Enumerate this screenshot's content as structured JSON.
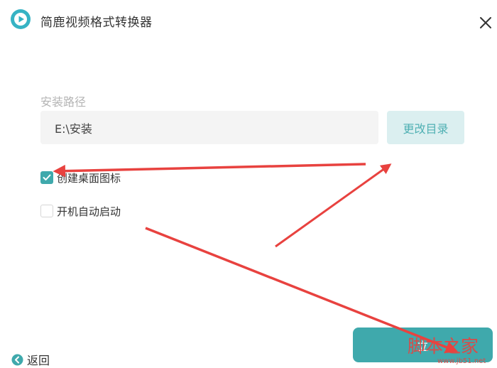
{
  "window": {
    "title": "简鹿视频格式转换器",
    "logo_icon": "play-logo-icon",
    "close_icon": "close-icon"
  },
  "install": {
    "path_label": "安装路径",
    "path_value": "E:\\安装",
    "change_dir_label": "更改目录",
    "install_label": "立"
  },
  "options": [
    {
      "label": "创建桌面图标",
      "checked": true
    },
    {
      "label": "开机自动启动",
      "checked": false
    }
  ],
  "footer": {
    "back_label": "返回",
    "back_icon": "arrow-left-circle-icon"
  },
  "watermark": {
    "text": "脚本之家",
    "subtext": "www.jb51.net"
  },
  "colors": {
    "accent": "#3fa9ac",
    "accent_light": "#dbeff0",
    "input_bg": "#f4f4f4",
    "label_gray": "#b4b4b4",
    "annotation_red": "#e8423f"
  }
}
